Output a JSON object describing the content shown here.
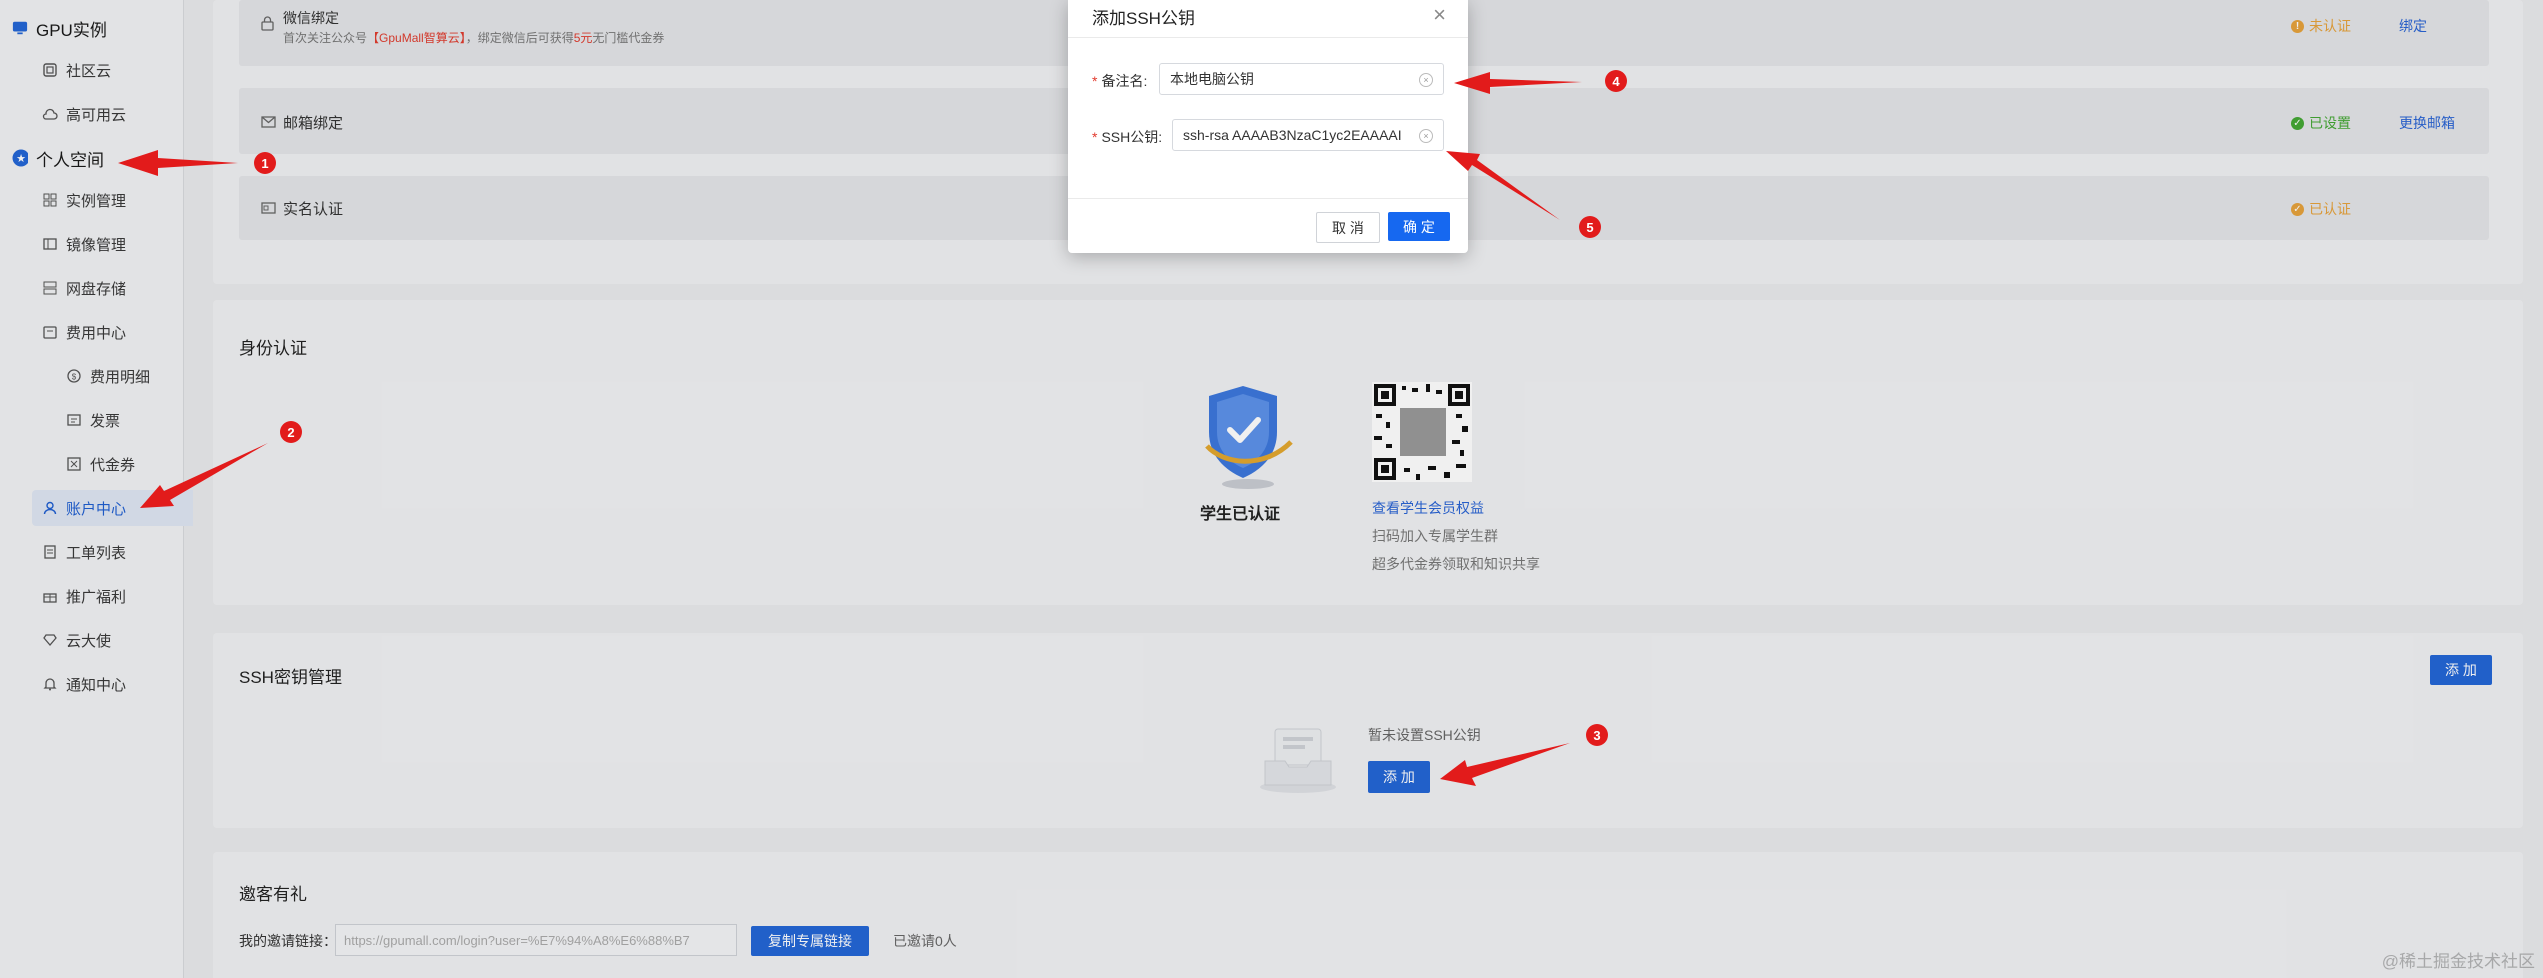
{
  "sidebar": {
    "brand": "GPU实例",
    "items": [
      {
        "label": "社区云",
        "icon": "grid-icon"
      },
      {
        "label": "高可用云",
        "icon": "cloud-icon"
      },
      {
        "label": "个人空间",
        "icon": "star-circle-icon"
      },
      {
        "label": "实例管理",
        "icon": "apps-icon"
      },
      {
        "label": "镜像管理",
        "icon": "image-icon"
      },
      {
        "label": "网盘存储",
        "icon": "storage-icon"
      },
      {
        "label": "费用中心",
        "icon": "wallet-icon"
      },
      {
        "label": "费用明细",
        "icon": "coin-icon"
      },
      {
        "label": "发票",
        "icon": "invoice-icon"
      },
      {
        "label": "代金券",
        "icon": "voucher-icon"
      },
      {
        "label": "账户中心",
        "icon": "user-icon"
      },
      {
        "label": "工单列表",
        "icon": "ticket-icon"
      },
      {
        "label": "推广福利",
        "icon": "gift-icon"
      },
      {
        "label": "云大使",
        "icon": "diamond-icon"
      },
      {
        "label": "通知中心",
        "icon": "bell-icon"
      }
    ]
  },
  "account": {
    "wechat": {
      "title": "微信绑定",
      "desc_before": "首次关注公众号",
      "desc_brand": "【GpuMall智算云】",
      "desc_mid": "，绑定微信后可获得",
      "desc_amount": "5元",
      "desc_after": "无门槛代金券",
      "status": "未认证",
      "action": "绑定"
    },
    "email": {
      "title": "邮箱绑定",
      "status": "已设置",
      "action": "更换邮箱"
    },
    "realname": {
      "title": "实名认证",
      "status": "已认证"
    }
  },
  "identity": {
    "title": "身份认证",
    "badge_label": "学生已认证",
    "link": "查看学生会员权益",
    "line1": "扫码加入专属学生群",
    "line2": "超多代金券领取和知识共享"
  },
  "ssh": {
    "title": "SSH密钥管理",
    "add_top": "添 加",
    "empty_text": "暂未设置SSH公钥",
    "add_center": "添 加"
  },
  "invite": {
    "title": "邀客有礼",
    "label": "我的邀请链接：",
    "link_value": "https://gpumall.com/login?user=%E7%94%A8%E6%88%B7",
    "copy_button": "复制专属链接",
    "count": "已邀请0人"
  },
  "modal": {
    "title": "添加SSH公钥",
    "remark_label": "备注名:",
    "remark_value": "本地电脑公钥",
    "key_label": "SSH公钥:",
    "key_value": "ssh-rsa AAAAB3NzaC1yc2EAAAAI",
    "cancel": "取 消",
    "ok": "确 定"
  },
  "annotations": [
    "1",
    "2",
    "3",
    "4",
    "5"
  ],
  "watermark": "@稀土掘金技术社区",
  "colors": {
    "primary": "#2466d6",
    "arrow": "#e21b1b",
    "success": "#45a735",
    "warning": "#e6a23c"
  }
}
